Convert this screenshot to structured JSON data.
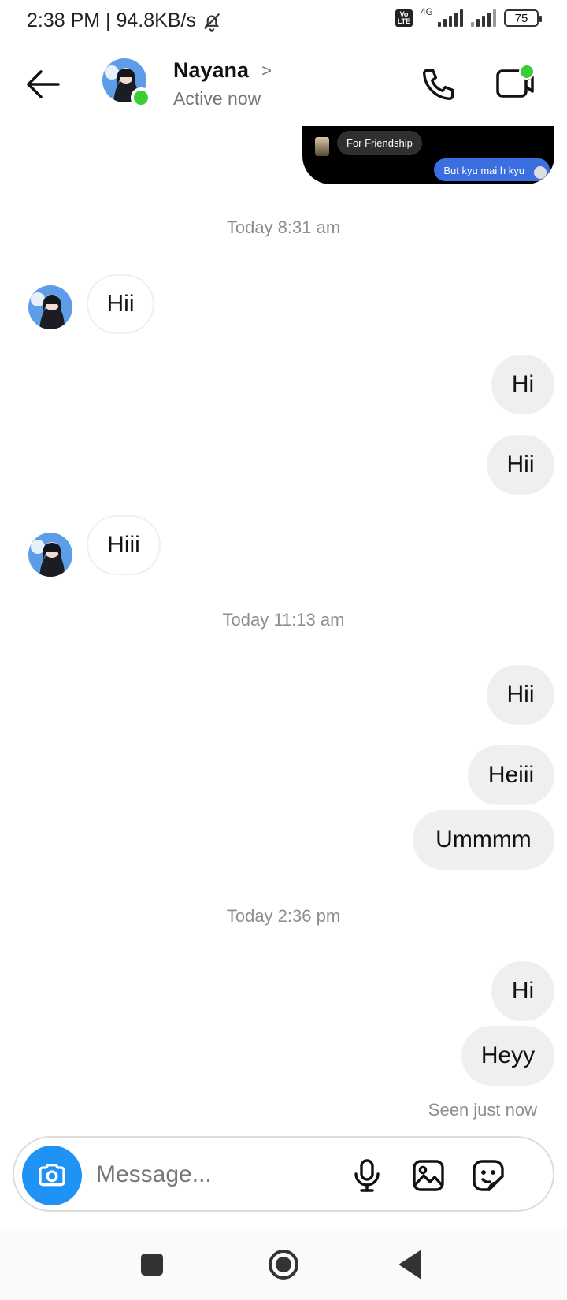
{
  "status": {
    "time_speed": "2:38 PM | 94.8KB/s",
    "volte": "Vo LTE",
    "network": "4G",
    "battery": "75"
  },
  "header": {
    "contact_name": "Nayana",
    "status": "Active now",
    "chevron": ">"
  },
  "preview": {
    "caption": "For Friendship",
    "reply": "But kyu mai h kyu"
  },
  "timestamps": {
    "t1": "Today 8:31 am",
    "t2": "Today 11:13 am",
    "t3": "Today 2:36 pm"
  },
  "messages": [
    {
      "from": "them",
      "text": "Hii"
    },
    {
      "from": "me",
      "text": "Hi"
    },
    {
      "from": "me",
      "text": "Hii"
    },
    {
      "from": "them",
      "text": "Hiii"
    },
    {
      "from": "me",
      "text": "Hii"
    },
    {
      "from": "me",
      "text": "Heiii"
    },
    {
      "from": "me",
      "text": "Ummmm"
    },
    {
      "from": "me",
      "text": "Hi"
    },
    {
      "from": "me",
      "text": "Heyy"
    }
  ],
  "seen": "Seen just now",
  "composer": {
    "placeholder": "Message..."
  },
  "colors": {
    "online": "#3ccc36",
    "camera": "#1e92f5",
    "reply_pill": "#3b6fe0"
  }
}
